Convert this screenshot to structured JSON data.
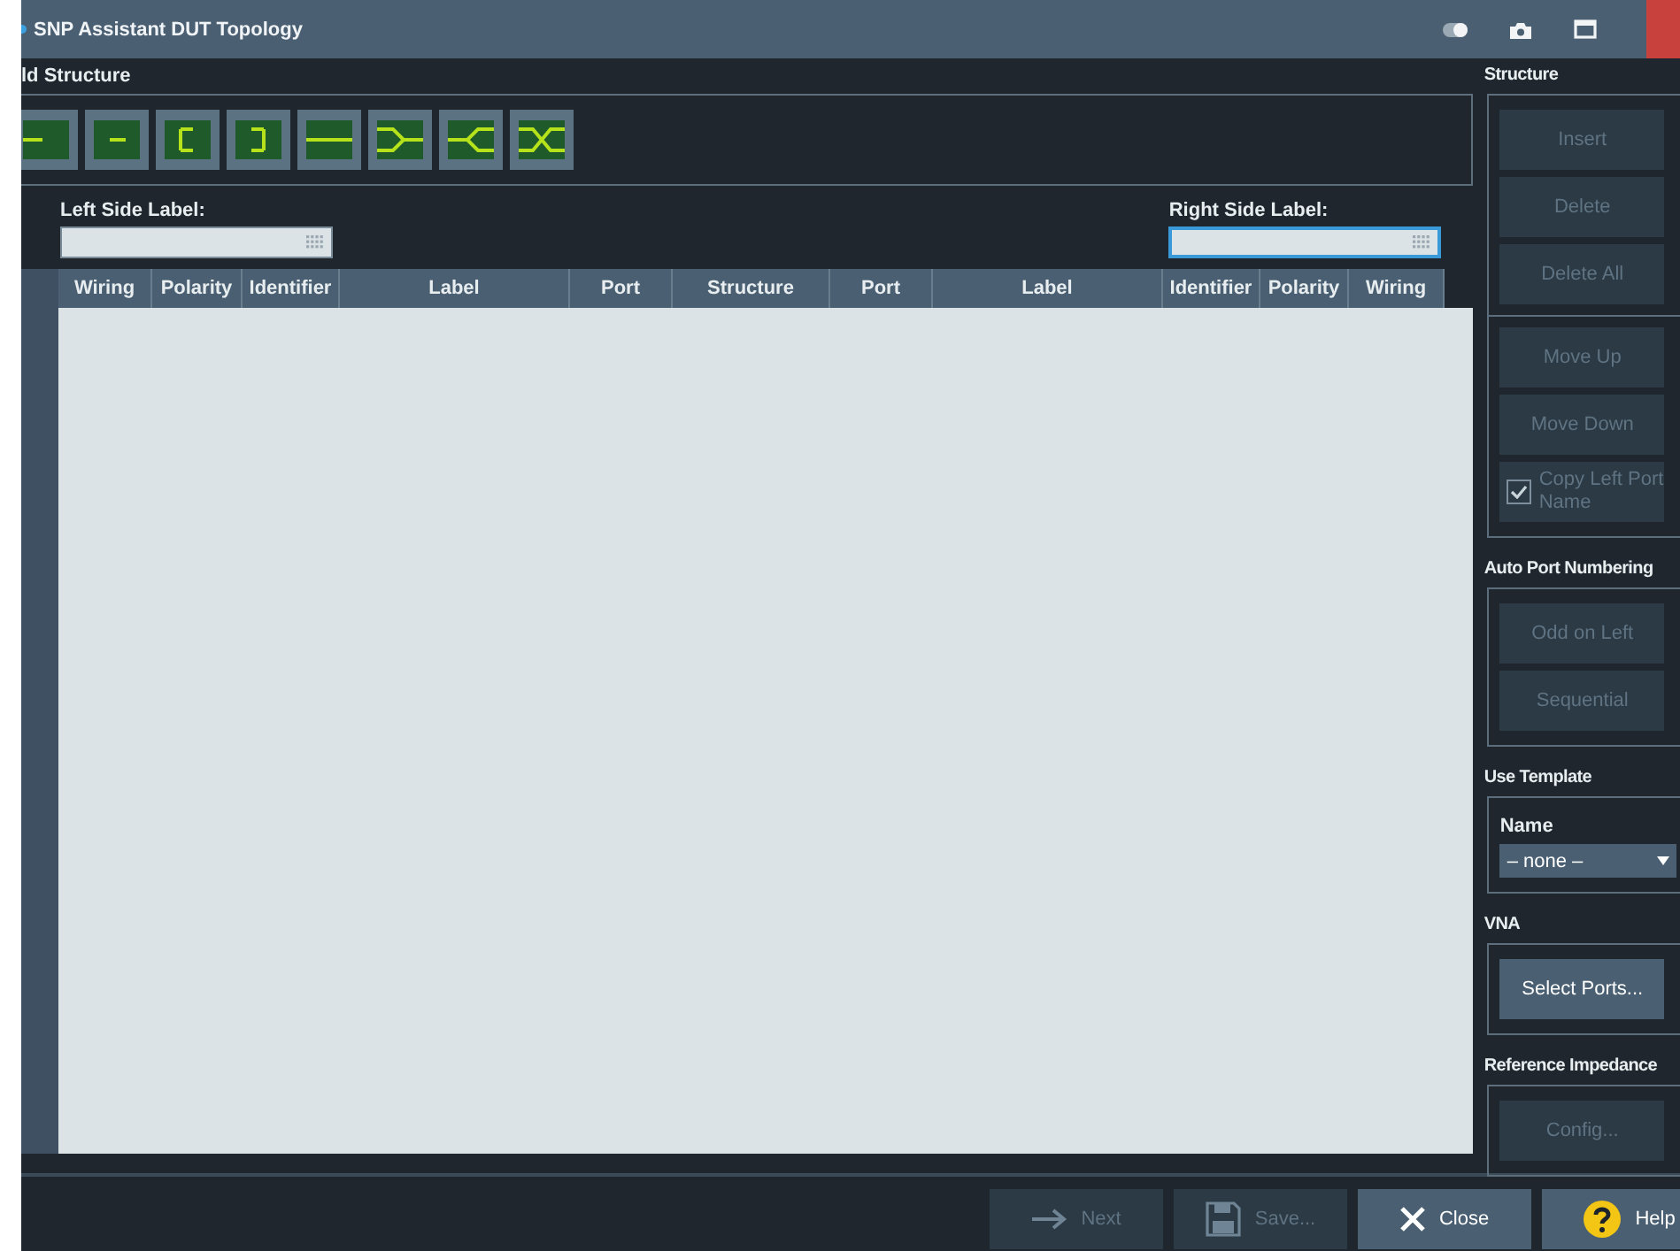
{
  "window": {
    "title": "SNP Assistant DUT Topology"
  },
  "add_structure": {
    "title": "ld Structure",
    "buttons": [
      {
        "kind": "stub-left"
      },
      {
        "kind": "stub-mid"
      },
      {
        "kind": "pair-left"
      },
      {
        "kind": "pair-right"
      },
      {
        "kind": "through"
      },
      {
        "kind": "join"
      },
      {
        "kind": "split"
      },
      {
        "kind": "cross"
      }
    ]
  },
  "left_side_label": {
    "label": "Left Side Label:",
    "focused": false
  },
  "right_side_label": {
    "label": "Right Side Label:",
    "focused": true
  },
  "table": {
    "columns": [
      "Wiring",
      "Polarity",
      "Identifier",
      "Label",
      "Port",
      "Structure",
      "Port",
      "Label",
      "Identifier",
      "Polarity",
      "Wiring"
    ]
  },
  "side_panel": [
    {
      "title": "Structure",
      "items": [
        {
          "kind": "button",
          "label": "Insert",
          "disabled": true
        },
        {
          "kind": "button",
          "label": "Delete",
          "disabled": true
        },
        {
          "kind": "button",
          "label": "Delete All",
          "disabled": true
        },
        {
          "kind": "separator"
        },
        {
          "kind": "button",
          "label": "Move Up",
          "disabled": true
        },
        {
          "kind": "button",
          "label": "Move Down",
          "disabled": true
        },
        {
          "kind": "checkbox",
          "label": "Copy Left Port Name",
          "checked": true,
          "disabled": true
        }
      ]
    },
    {
      "title": "Auto Port Numbering",
      "items": [
        {
          "kind": "button",
          "label": "Odd on Left",
          "disabled": true
        },
        {
          "kind": "button",
          "label": "Sequential",
          "disabled": true
        }
      ]
    },
    {
      "title": "Use Template",
      "items": [
        {
          "kind": "dropdown",
          "label": "Name",
          "value": "– none –"
        }
      ]
    },
    {
      "title": "VNA",
      "items": [
        {
          "kind": "button",
          "label": "Select Ports...",
          "disabled": false
        }
      ]
    },
    {
      "title": "Reference Impedance",
      "items": [
        {
          "kind": "button",
          "label": "Config...",
          "disabled": true
        }
      ]
    }
  ],
  "footer_buttons": [
    {
      "kind": "next",
      "label": "Next",
      "disabled": true
    },
    {
      "kind": "save",
      "label": "Save...",
      "disabled": true
    },
    {
      "kind": "close",
      "label": "Close",
      "disabled": false
    },
    {
      "kind": "help",
      "label": "Help",
      "disabled": false
    }
  ]
}
